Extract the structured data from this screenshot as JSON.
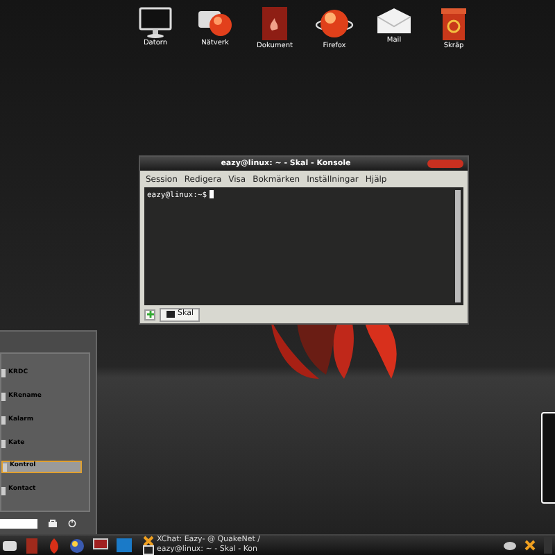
{
  "desktop_icons": [
    {
      "label": "Datorn",
      "kind": "monitor"
    },
    {
      "label": "Nätverk",
      "kind": "network"
    },
    {
      "label": "Dokument",
      "kind": "document"
    },
    {
      "label": "Firefox",
      "kind": "globe"
    },
    {
      "label": "Mail",
      "kind": "mail"
    },
    {
      "label": "Skräp",
      "kind": "trash"
    }
  ],
  "konsole": {
    "title": "eazy@linux: ~ - Skal - Konsole",
    "menu": [
      "Session",
      "Redigera",
      "Visa",
      "Bokmärken",
      "Inställningar",
      "Hjälp"
    ],
    "prompt": "eazy@linux:~$",
    "tabs": [
      {
        "label": "Skal",
        "selected": true
      }
    ]
  },
  "start_menu": {
    "items": [
      {
        "label": "KRDC",
        "selected": false
      },
      {
        "label": "KRename",
        "selected": false
      },
      {
        "label": "Kalarm",
        "selected": false
      },
      {
        "label": "Kate",
        "selected": false
      },
      {
        "label": "Kontrol",
        "selected": true
      },
      {
        "label": "Kontact",
        "selected": false
      }
    ]
  },
  "taskbar": {
    "tasks": [
      {
        "label": "XChat: Eazy- @ QuakeNet /",
        "kind": "chat"
      },
      {
        "label": "eazy@linux: ~ - Skal - Kon",
        "kind": "terminal"
      }
    ]
  }
}
